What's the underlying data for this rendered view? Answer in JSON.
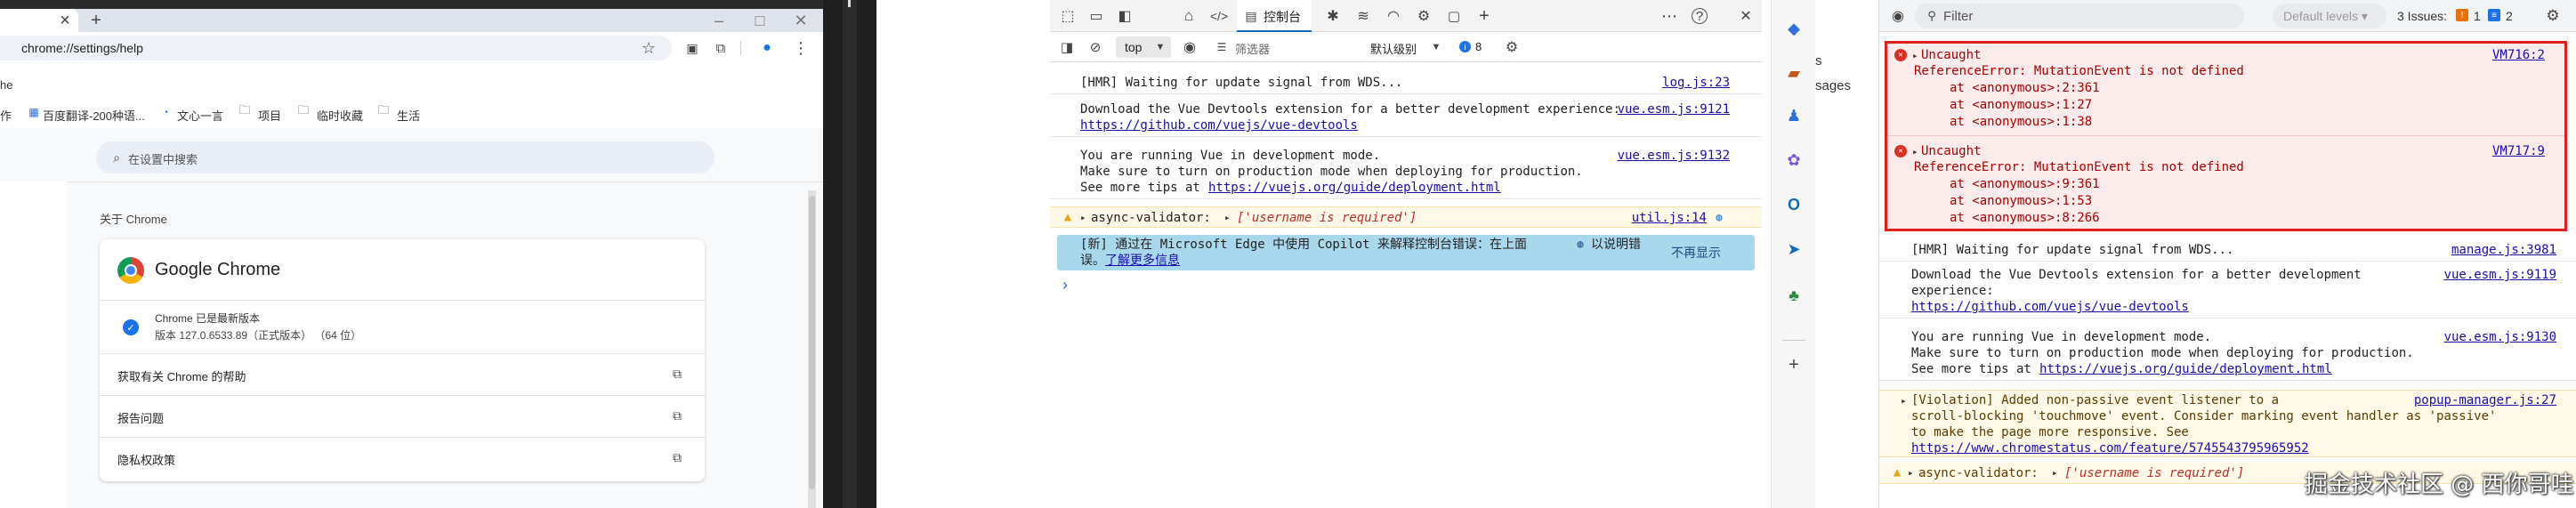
{
  "chrome": {
    "tab_close": "×",
    "tab_new": "+",
    "win_min": "–",
    "win_max": "□",
    "win_close": "✕",
    "url": "chrome://settings/help",
    "bookmarks": [
      "作",
      "百度翻译-200种语...",
      "文心一言",
      "项目",
      "临时收藏",
      "生活"
    ],
    "left_edge_text": "he",
    "search_placeholder": "在设置中搜索",
    "about_title": "关于 Chrome",
    "product_name": "Google Chrome",
    "status_title": "Chrome 已是最新版本",
    "version": "版本 127.0.6533.89（正式版本）  （64 位）",
    "links": [
      "获取有关 Chrome 的帮助",
      "报告问题",
      "隐私权政策"
    ]
  },
  "devtools_mid": {
    "tab_console": "控制台",
    "context": "top",
    "filter_placeholder": "筛选器",
    "levels": "默认级别",
    "issue_count": "8",
    "messages": [
      {
        "text": "[HMR] Waiting for update signal from WDS...",
        "src": "log.js:23"
      },
      {
        "text": "Download the Vue Devtools extension for a better development experience:",
        "link": "https://github.com/vuejs/vue-devtools",
        "src": "vue.esm.js:9121"
      },
      {
        "line1": "You are running Vue in development mode.",
        "line2": "Make sure to turn on production mode when deploying for production.",
        "line3_pre": "See more tips at ",
        "link": "https://vuejs.org/guide/deployment.html",
        "src": "vue.esm.js:9132"
      }
    ],
    "warn": {
      "label": "async-validator:",
      "value": "['username is required']",
      "src": "util.js:14"
    },
    "copilot": {
      "line1": "[新] 通过在 Microsoft Edge 中使用 Copilot 来解释控制台错误：在上面",
      "line1_tail": "以说明错",
      "line2": "误。",
      "link": "了解更多信息",
      "dismiss": "不再显示"
    },
    "prompt": "›"
  },
  "devtools_right": {
    "filter_placeholder": "Filter",
    "levels": "Default levels ▾",
    "issues_label": "3 Issues:",
    "issues_err": "1",
    "issues_info": "2",
    "left_sliver": "sages",
    "errors": [
      {
        "head": "Uncaught",
        "src": "VM716:2",
        "msg": "ReferenceError: MutationEvent is not defined",
        "stack": [
          "at <anonymous>:2:361",
          "at <anonymous>:1:27",
          "at <anonymous>:1:38"
        ]
      },
      {
        "head": "Uncaught",
        "src": "VM717:9",
        "msg": "ReferenceError: MutationEvent is not defined",
        "stack": [
          "at <anonymous>:9:361",
          "at <anonymous>:1:53",
          "at <anonymous>:8:266"
        ]
      }
    ],
    "messages": [
      {
        "text": "[HMR] Waiting for update signal from WDS...",
        "src": "manage.js:3981"
      },
      {
        "line1": "Download the Vue Devtools extension for a better development",
        "line2": "experience:",
        "link": "https://github.com/vuejs/vue-devtools",
        "src": "vue.esm.js:9119"
      },
      {
        "line1": "You are running Vue in development mode.",
        "line2": "Make sure to turn on production mode when deploying for production.",
        "line3_pre": "See more tips at ",
        "link": "https://vuejs.org/guide/deployment.html",
        "src": "vue.esm.js:9130"
      }
    ],
    "violation": {
      "line1": "[Violation] Added non-passive event listener to a",
      "line2": "scroll-blocking 'touchmove' event. Consider marking event handler as 'passive'",
      "line3": "to make the page more responsive. See",
      "link": "https://www.chromestatus.com/feature/5745543795965952",
      "src": "popup-manager.js:27"
    },
    "warn": {
      "label": "async-validator:",
      "value": "['username is required']"
    },
    "watermark": "掘金技术社区 @ 西你哥哇"
  },
  "colors": {
    "error_bg": "#fcebeb",
    "error_border": "#e02020",
    "warn_bg": "#fef9e6",
    "info_bg": "#a8d8ec",
    "link": "#1a0dab",
    "accent_blue": "#1a73e8"
  }
}
